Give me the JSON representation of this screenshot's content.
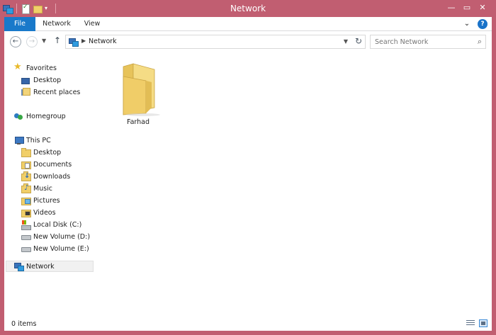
{
  "window": {
    "title": "Network"
  },
  "ribbon": {
    "tabs": [
      {
        "label": "File"
      },
      {
        "label": "Network"
      },
      {
        "label": "View"
      }
    ]
  },
  "navbar": {
    "breadcrumb": "Network",
    "search_placeholder": "Search Network"
  },
  "nav_pane": {
    "favorites": {
      "label": "Favorites",
      "items": [
        {
          "label": "Desktop",
          "icon": "desktop-icon"
        },
        {
          "label": "Recent places",
          "icon": "recent-places-icon"
        }
      ]
    },
    "homegroup": {
      "label": "Homegroup",
      "icon": "homegroup-icon"
    },
    "this_pc": {
      "label": "This PC",
      "items": [
        {
          "label": "Desktop",
          "icon": "desktop-icon"
        },
        {
          "label": "Documents",
          "icon": "documents-folder-icon"
        },
        {
          "label": "Downloads",
          "icon": "downloads-folder-icon"
        },
        {
          "label": "Music",
          "icon": "music-folder-icon"
        },
        {
          "label": "Pictures",
          "icon": "pictures-folder-icon"
        },
        {
          "label": "Videos",
          "icon": "videos-folder-icon"
        },
        {
          "label": "Local Disk (C:)",
          "icon": "system-drive-icon"
        },
        {
          "label": "New Volume (D:)",
          "icon": "drive-icon"
        },
        {
          "label": "New Volume (E:)",
          "icon": "drive-icon"
        }
      ]
    },
    "network": {
      "label": "Network",
      "icon": "network-icon",
      "selected": true
    }
  },
  "content": {
    "items": [
      {
        "label": "Farhad",
        "icon": "folder-icon"
      }
    ]
  },
  "statusbar": {
    "count": "0 items"
  },
  "colors": {
    "frame": "#c15e71",
    "file_tab": "#1979ca",
    "folder": "#f1cf69"
  }
}
